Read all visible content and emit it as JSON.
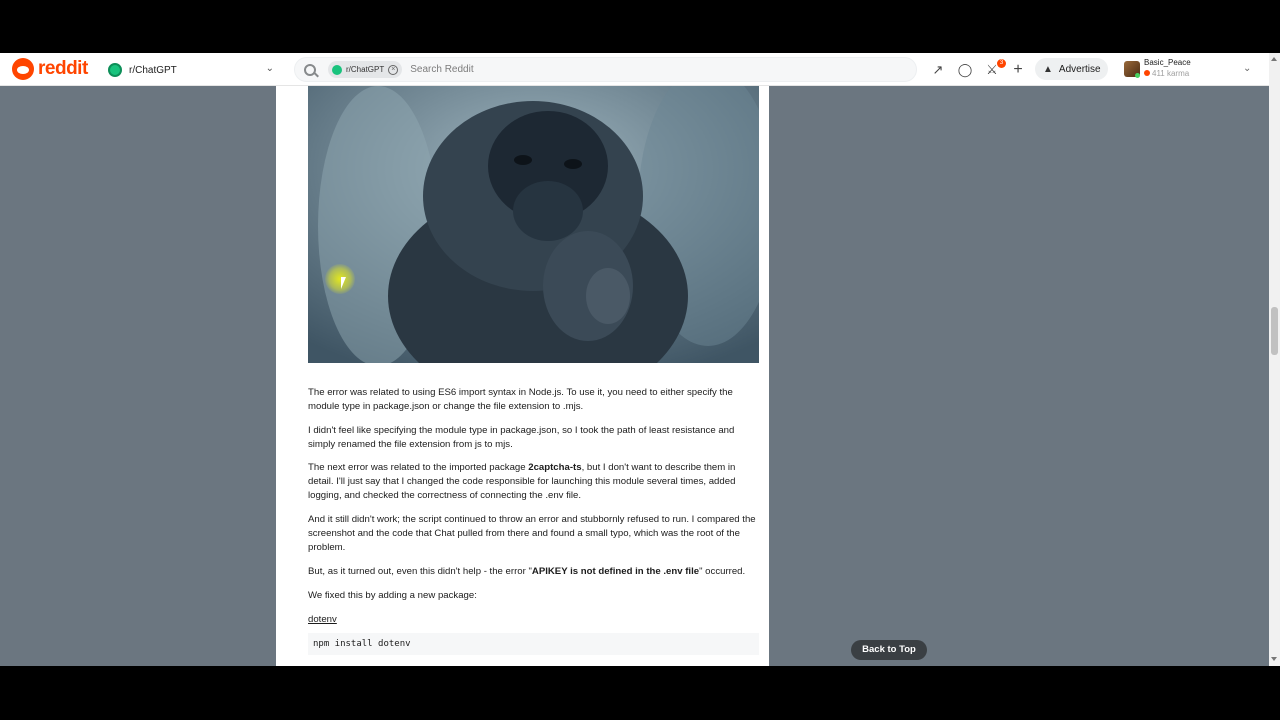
{
  "header": {
    "logo_text": "reddit",
    "community": "r/ChatGPT",
    "search_chip": "r/ChatGPT",
    "search_placeholder": "Search Reddit",
    "notification_count": "3",
    "advertise_label": "Advertise",
    "username": "Basic_Peace",
    "karma": "411 karma"
  },
  "post": {
    "paragraphs": [
      "The error was related to using ES6 import syntax in Node.js. To use it, you need to either specify the module type in package.json or change the file extension to .mjs.",
      "I didn't feel like specifying the module type in package.json, so I took the path of least resistance and simply renamed the file extension from js to mjs.",
      "And it still didn't work; the script continued to throw an error and stubbornly refused to run. I compared the screenshot and the code that Chat pulled from there and found a small typo, which was the root of the problem.",
      "We fixed this by adding a new package:"
    ],
    "p3_prefix": "The next error was related to the imported package ",
    "p3_bold": "2captcha-ts",
    "p3_suffix": ", but I don't want to describe them in detail. I'll just say that I changed the code responsible for launching this module several times, added logging, and checked the correctness of connecting the .env file.",
    "p5_prefix": "But, as it turned out, even this didn't help - the error \"",
    "p5_bold": "APIKEY is not defined in the .env file",
    "p5_suffix": "\" occurred.",
    "link_text": "dotenv",
    "code_text": "npm install dotenv"
  },
  "back_to_top": "Back to Top"
}
